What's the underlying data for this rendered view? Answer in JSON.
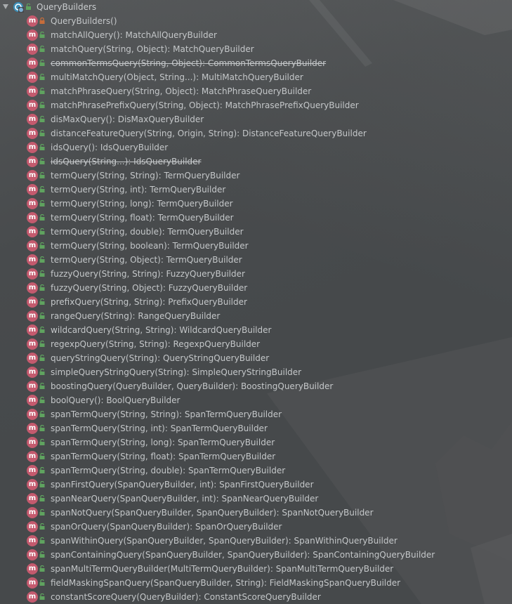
{
  "tree": {
    "root_label": "QueryBuilders",
    "items": [
      {
        "label": "QueryBuilders()",
        "visibility": "private",
        "deprecated": false
      },
      {
        "label": "matchAllQuery(): MatchAllQueryBuilder",
        "visibility": "public",
        "deprecated": false
      },
      {
        "label": "matchQuery(String, Object): MatchQueryBuilder",
        "visibility": "public",
        "deprecated": false
      },
      {
        "label": "commonTermsQuery(String, Object): CommonTermsQueryBuilder",
        "visibility": "public",
        "deprecated": true
      },
      {
        "label": "multiMatchQuery(Object, String...): MultiMatchQueryBuilder",
        "visibility": "public",
        "deprecated": false
      },
      {
        "label": "matchPhraseQuery(String, Object): MatchPhraseQueryBuilder",
        "visibility": "public",
        "deprecated": false
      },
      {
        "label": "matchPhrasePrefixQuery(String, Object): MatchPhrasePrefixQueryBuilder",
        "visibility": "public",
        "deprecated": false
      },
      {
        "label": "disMaxQuery(): DisMaxQueryBuilder",
        "visibility": "public",
        "deprecated": false
      },
      {
        "label": "distanceFeatureQuery(String, Origin, String): DistanceFeatureQueryBuilder",
        "visibility": "public",
        "deprecated": false
      },
      {
        "label": "idsQuery(): IdsQueryBuilder",
        "visibility": "public",
        "deprecated": false
      },
      {
        "label": "idsQuery(String...): IdsQueryBuilder",
        "visibility": "public",
        "deprecated": true
      },
      {
        "label": "termQuery(String, String): TermQueryBuilder",
        "visibility": "public",
        "deprecated": false
      },
      {
        "label": "termQuery(String, int): TermQueryBuilder",
        "visibility": "public",
        "deprecated": false
      },
      {
        "label": "termQuery(String, long): TermQueryBuilder",
        "visibility": "public",
        "deprecated": false
      },
      {
        "label": "termQuery(String, float): TermQueryBuilder",
        "visibility": "public",
        "deprecated": false
      },
      {
        "label": "termQuery(String, double): TermQueryBuilder",
        "visibility": "public",
        "deprecated": false
      },
      {
        "label": "termQuery(String, boolean): TermQueryBuilder",
        "visibility": "public",
        "deprecated": false
      },
      {
        "label": "termQuery(String, Object): TermQueryBuilder",
        "visibility": "public",
        "deprecated": false
      },
      {
        "label": "fuzzyQuery(String, String): FuzzyQueryBuilder",
        "visibility": "public",
        "deprecated": false
      },
      {
        "label": "fuzzyQuery(String, Object): FuzzyQueryBuilder",
        "visibility": "public",
        "deprecated": false
      },
      {
        "label": "prefixQuery(String, String): PrefixQueryBuilder",
        "visibility": "public",
        "deprecated": false
      },
      {
        "label": "rangeQuery(String): RangeQueryBuilder",
        "visibility": "public",
        "deprecated": false
      },
      {
        "label": "wildcardQuery(String, String): WildcardQueryBuilder",
        "visibility": "public",
        "deprecated": false
      },
      {
        "label": "regexpQuery(String, String): RegexpQueryBuilder",
        "visibility": "public",
        "deprecated": false
      },
      {
        "label": "queryStringQuery(String): QueryStringQueryBuilder",
        "visibility": "public",
        "deprecated": false
      },
      {
        "label": "simpleQueryStringQuery(String): SimpleQueryStringBuilder",
        "visibility": "public",
        "deprecated": false
      },
      {
        "label": "boostingQuery(QueryBuilder, QueryBuilder): BoostingQueryBuilder",
        "visibility": "public",
        "deprecated": false
      },
      {
        "label": "boolQuery(): BoolQueryBuilder",
        "visibility": "public",
        "deprecated": false
      },
      {
        "label": "spanTermQuery(String, String): SpanTermQueryBuilder",
        "visibility": "public",
        "deprecated": false
      },
      {
        "label": "spanTermQuery(String, int): SpanTermQueryBuilder",
        "visibility": "public",
        "deprecated": false
      },
      {
        "label": "spanTermQuery(String, long): SpanTermQueryBuilder",
        "visibility": "public",
        "deprecated": false
      },
      {
        "label": "spanTermQuery(String, float): SpanTermQueryBuilder",
        "visibility": "public",
        "deprecated": false
      },
      {
        "label": "spanTermQuery(String, double): SpanTermQueryBuilder",
        "visibility": "public",
        "deprecated": false
      },
      {
        "label": "spanFirstQuery(SpanQueryBuilder, int): SpanFirstQueryBuilder",
        "visibility": "public",
        "deprecated": false
      },
      {
        "label": "spanNearQuery(SpanQueryBuilder, int): SpanNearQueryBuilder",
        "visibility": "public",
        "deprecated": false
      },
      {
        "label": "spanNotQuery(SpanQueryBuilder, SpanQueryBuilder): SpanNotQueryBuilder",
        "visibility": "public",
        "deprecated": false
      },
      {
        "label": "spanOrQuery(SpanQueryBuilder): SpanOrQueryBuilder",
        "visibility": "public",
        "deprecated": false
      },
      {
        "label": "spanWithinQuery(SpanQueryBuilder, SpanQueryBuilder): SpanWithinQueryBuilder",
        "visibility": "public",
        "deprecated": false
      },
      {
        "label": "spanContainingQuery(SpanQueryBuilder, SpanQueryBuilder): SpanContainingQueryBuilder",
        "visibility": "public",
        "deprecated": false
      },
      {
        "label": "spanMultiTermQueryBuilder(MultiTermQueryBuilder): SpanMultiTermQueryBuilder",
        "visibility": "public",
        "deprecated": false
      },
      {
        "label": "fieldMaskingSpanQuery(SpanQueryBuilder, String): FieldMaskingSpanQueryBuilder",
        "visibility": "public",
        "deprecated": false
      },
      {
        "label": "constantScoreQuery(QueryBuilder): ConstantScoreQueryBuilder",
        "visibility": "public",
        "deprecated": false
      }
    ]
  },
  "icons": {
    "expand": "triangle-down-icon",
    "class": "class-icon",
    "method": "method-icon",
    "method_letter": "m",
    "public": "unlock-icon",
    "private": "lock-icon"
  },
  "colors": {
    "method_badge": "#c45a6e",
    "public": "#5fa35f",
    "private": "#c76d3b",
    "text": "#c4c7c9",
    "background": "#46494b"
  }
}
